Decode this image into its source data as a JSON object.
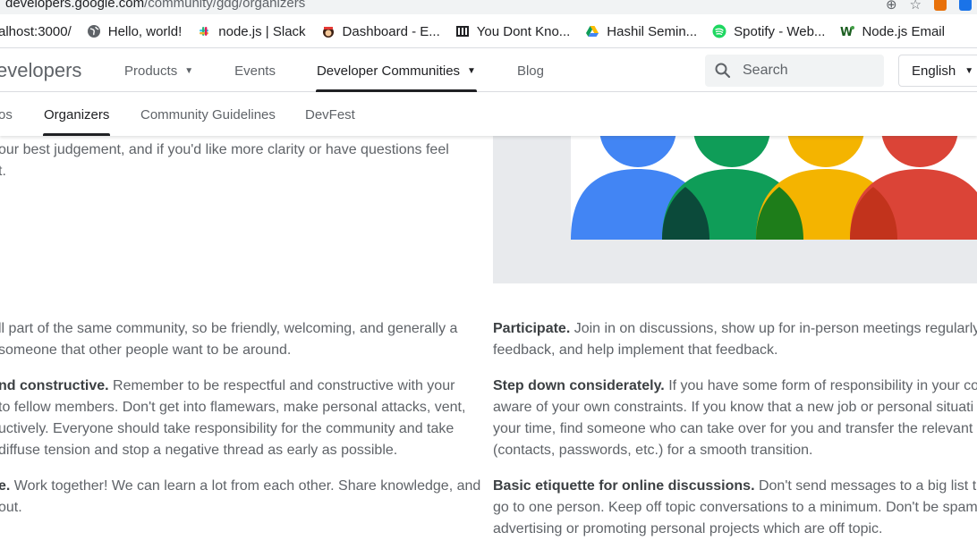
{
  "browser": {
    "url_host": "developers.google.com",
    "url_path": "/community/gdg/organizers",
    "bookmarks": [
      {
        "label": "alhost:3000/",
        "icon": "none"
      },
      {
        "label": "Hello, world!",
        "icon": "globe-icon"
      },
      {
        "label": "node.js | Slack",
        "icon": "slack-icon"
      },
      {
        "label": "Dashboard - E...",
        "icon": "dashboard-icon"
      },
      {
        "label": "You Dont Kno...",
        "icon": "book-icon"
      },
      {
        "label": "Hashil Semin...",
        "icon": "drive-icon"
      },
      {
        "label": "Spotify - Web...",
        "icon": "spotify-icon"
      },
      {
        "label": "Node.js Email",
        "icon": "w-icon"
      }
    ]
  },
  "header": {
    "logo": "evelopers",
    "nav": [
      {
        "label": "Products",
        "dropdown": true
      },
      {
        "label": "Events",
        "dropdown": false
      },
      {
        "label": "Developer Communities",
        "dropdown": true,
        "active": true
      },
      {
        "label": "Blog",
        "dropdown": false
      }
    ],
    "search_placeholder": "Search",
    "language": "English"
  },
  "subnav": {
    "items": [
      {
        "label": "os",
        "active": false
      },
      {
        "label": "Organizers",
        "active": true
      },
      {
        "label": "Community Guidelines",
        "active": false
      },
      {
        "label": "DevFest",
        "active": false
      }
    ]
  },
  "content": {
    "intro": {
      "line1": "our best judgement, and if you'd like more clarity or have questions feel",
      "line2": "t."
    },
    "left": [
      {
        "bold": "",
        "lines": [
          "ll part of the same community, so be friendly, welcoming, and generally a",
          "someone that other people want to be around."
        ]
      },
      {
        "bold": "nd constructive.",
        "lines": [
          " Remember to be respectful and constructive with your",
          " to fellow members. Don't get into flamewars, make personal attacks, vent,",
          "uctively. Everyone should take responsibility for the community and take",
          "diffuse tension and stop a negative thread as early as possible."
        ]
      },
      {
        "bold": "e.",
        "lines": [
          " Work together! We can learn a lot from each other. Share knowledge, and",
          "out."
        ]
      }
    ],
    "right": [
      {
        "bold": "Participate.",
        "lines": [
          " Join in on discussions, show up for in-person meetings regularly",
          "feedback, and help implement that feedback."
        ]
      },
      {
        "bold": "Step down considerately.",
        "lines": [
          " If you have some form of responsibility in your con",
          "aware of your own constraints. If you know that a new job or personal situati",
          "your time, find someone who can take over for you and transfer the relevant i",
          "(contacts, passwords, etc.) for a smooth transition."
        ]
      },
      {
        "bold": "Basic etiquette for online discussions.",
        "lines": [
          " Don't send messages to a big list that",
          "go to one person. Keep off topic conversations to a minimum. Don't be spam",
          "advertising or promoting personal projects which are off topic."
        ]
      }
    ]
  },
  "colors": {
    "blue": "#4285f4",
    "green": "#0f9d58",
    "yellow": "#f4b400",
    "red": "#db4437",
    "text": "#5f6368"
  }
}
